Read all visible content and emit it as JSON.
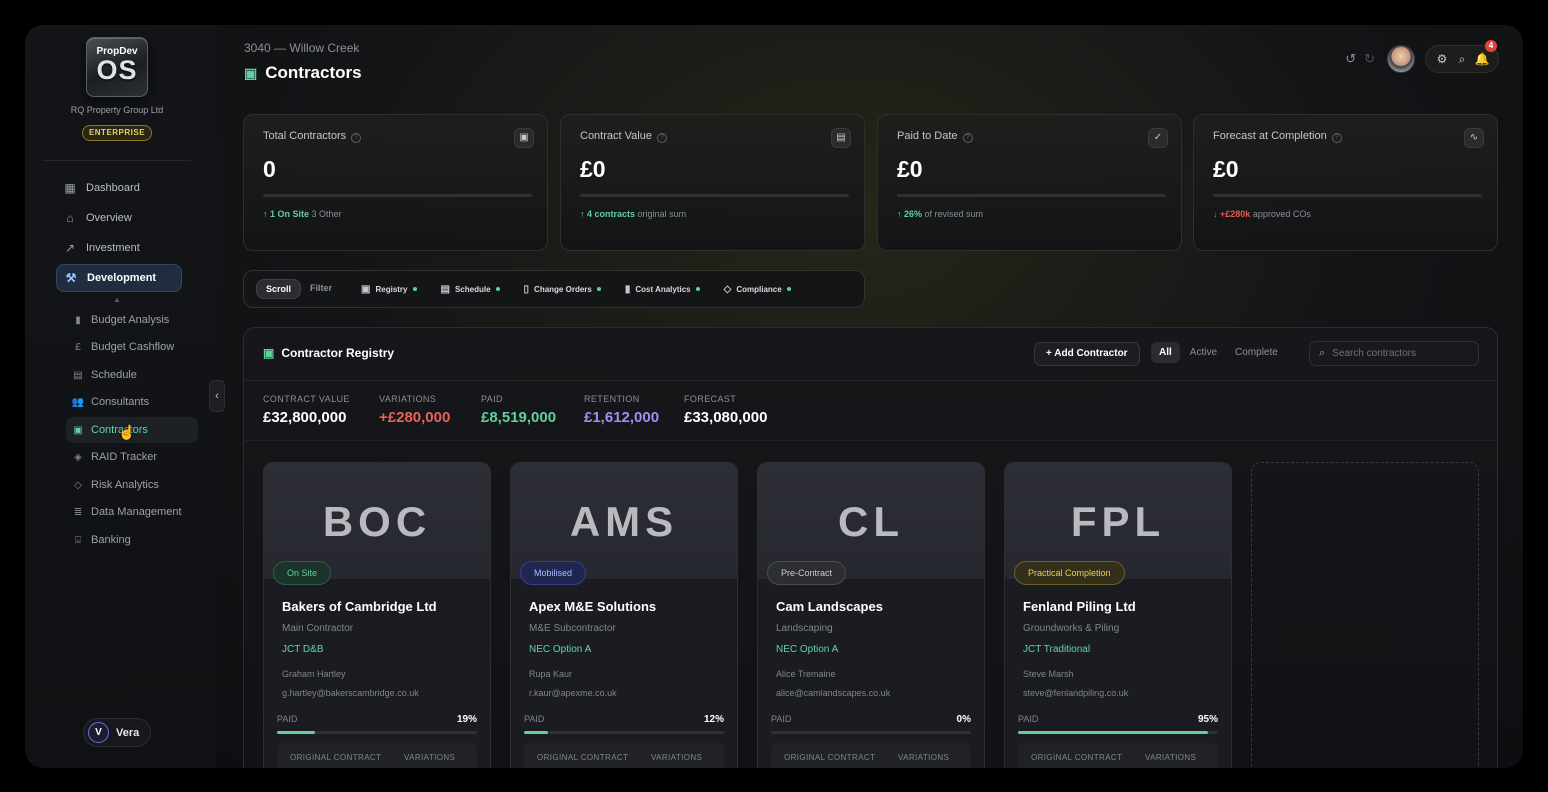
{
  "brand": {
    "logo_top": "PropDev",
    "logo_main": "OS",
    "org": "RQ Property Group Ltd",
    "tier": "ENTERPRISE"
  },
  "nav": {
    "items": [
      {
        "label": "Dashboard",
        "icon": "grid-icon"
      },
      {
        "label": "Overview",
        "icon": "home-icon"
      },
      {
        "label": "Investment",
        "icon": "line-chart-icon"
      },
      {
        "label": "Development",
        "icon": "hammer-icon"
      }
    ],
    "sub_items": [
      {
        "label": "Budget Analysis",
        "icon": "bar-chart-icon"
      },
      {
        "label": "Budget Cashflow",
        "icon": "pound-icon"
      },
      {
        "label": "Schedule",
        "icon": "calendar-icon"
      },
      {
        "label": "Consultants",
        "icon": "users-icon"
      },
      {
        "label": "Contractors",
        "icon": "briefcase-icon"
      },
      {
        "label": "RAID Tracker",
        "icon": "shield-check-icon"
      },
      {
        "label": "Risk Analytics",
        "icon": "shield-icon"
      },
      {
        "label": "Data Management",
        "icon": "database-icon"
      },
      {
        "label": "Banking",
        "icon": "bank-icon"
      }
    ]
  },
  "user": {
    "initial": "V",
    "name": "Vera"
  },
  "header": {
    "breadcrumb": "3040 — Willow Creek",
    "title": "Contractors",
    "notification_count": "4"
  },
  "kpis": [
    {
      "label": "Total Contractors",
      "value": "0",
      "foot_highlight": "↑ 1 On Site",
      "foot_text": "3 Other",
      "trend": "up",
      "icon": "briefcase-icon"
    },
    {
      "label": "Contract Value",
      "value": "£0",
      "foot_highlight": "↑ 4 contracts",
      "foot_text": "original sum",
      "trend": "up",
      "icon": "document-icon"
    },
    {
      "label": "Paid to Date",
      "value": "£0",
      "foot_highlight": "↑ 26%",
      "foot_text": "of revised sum",
      "trend": "up",
      "icon": "check-icon"
    },
    {
      "label": "Forecast at Completion",
      "value": "£0",
      "foot_highlight": "↓ +£280k",
      "foot_text": "approved COs",
      "trend": "down",
      "icon": "pulse-icon"
    }
  ],
  "tabbar": {
    "toggle": [
      "Scroll",
      "Filter"
    ],
    "tabs": [
      {
        "label": "Registry",
        "icon": "briefcase-icon"
      },
      {
        "label": "Schedule",
        "icon": "calendar-icon"
      },
      {
        "label": "Change Orders",
        "icon": "document-icon"
      },
      {
        "label": "Cost Analytics",
        "icon": "bar-chart-icon"
      },
      {
        "label": "Compliance",
        "icon": "shield-icon"
      }
    ]
  },
  "registry": {
    "title": "Contractor Registry",
    "add_label": "+ Add Contractor",
    "filters": [
      "All",
      "Active",
      "Complete"
    ],
    "search_placeholder": "Search contractors",
    "stats": [
      {
        "label": "CONTRACT VALUE",
        "value": "£32,800,000",
        "color": "#ffffff"
      },
      {
        "label": "VARIATIONS",
        "value": "+£280,000",
        "color": "#e8625a"
      },
      {
        "label": "PAID",
        "value": "£8,519,000",
        "color": "#5fd19f"
      },
      {
        "label": "RETENTION",
        "value": "£1,612,000",
        "color": "#a58cf0"
      },
      {
        "label": "FORECAST",
        "value": "£33,080,000",
        "color": "#ffffff"
      }
    ],
    "cards": [
      {
        "initials": "BOC",
        "status": "On Site",
        "status_color": "#5fd19f",
        "name": "Bakers of Cambridge Ltd",
        "role": "Main Contractor",
        "contract": "JCT D&B",
        "person": "Graham Hartley",
        "email": "g.hartley@bakerscambridge.co.uk",
        "paid_label": "PAID",
        "paid_pct": "19%",
        "paid_fraction": 0.19,
        "foot_labels": [
          "ORIGINAL CONTRACT",
          "VARIATIONS"
        ]
      },
      {
        "initials": "AMS",
        "status": "Mobilised",
        "status_color": "#8aa6ff",
        "name": "Apex M&E Solutions",
        "role": "M&E Subcontractor",
        "contract": "NEC Option A",
        "person": "Rupa Kaur",
        "email": "r.kaur@apexme.co.uk",
        "paid_label": "PAID",
        "paid_pct": "12%",
        "paid_fraction": 0.12,
        "foot_labels": [
          "ORIGINAL CONTRACT",
          "VARIATIONS"
        ]
      },
      {
        "initials": "CL",
        "status": "Pre-Contract",
        "status_color": "#c8ccd2",
        "name": "Cam Landscapes",
        "role": "Landscaping",
        "contract": "NEC Option A",
        "person": "Alice Tremaine",
        "email": "alice@camlandscapes.co.uk",
        "paid_label": "PAID",
        "paid_pct": "0%",
        "paid_fraction": 0.0,
        "foot_labels": [
          "ORIGINAL CONTRACT",
          "VARIATIONS"
        ]
      },
      {
        "initials": "FPL",
        "status": "Practical Completion",
        "status_color": "#e7cf63",
        "name": "Fenland Piling Ltd",
        "role": "Groundworks & Piling",
        "contract": "JCT Traditional",
        "person": "Steve Marsh",
        "email": "steve@fenlandpiling.co.uk",
        "paid_label": "PAID",
        "paid_pct": "95%",
        "paid_fraction": 0.95,
        "foot_labels": [
          "ORIGINAL CONTRACT",
          "VARIATIONS"
        ]
      }
    ]
  }
}
